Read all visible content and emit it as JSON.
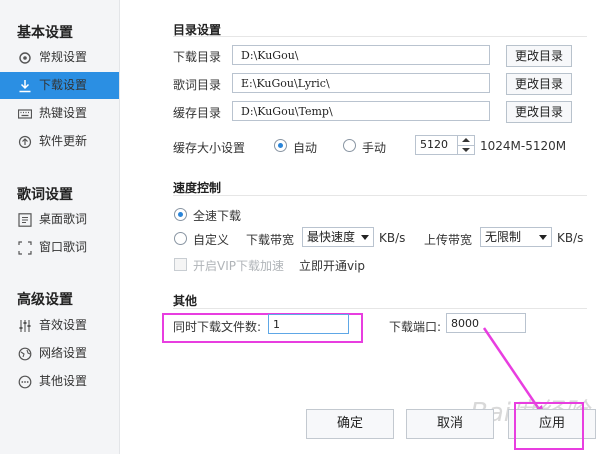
{
  "sidebar": {
    "sections": [
      {
        "title": "基本设置",
        "items": [
          {
            "label": "常规设置",
            "icon": "gear-icon"
          },
          {
            "label": "下载设置",
            "icon": "download-icon",
            "active": true
          },
          {
            "label": "热键设置",
            "icon": "keyboard-icon"
          },
          {
            "label": "软件更新",
            "icon": "update-icon"
          }
        ]
      },
      {
        "title": "歌词设置",
        "items": [
          {
            "label": "桌面歌词",
            "icon": "desktop-lyric-icon"
          },
          {
            "label": "窗口歌词",
            "icon": "window-lyric-icon"
          }
        ]
      },
      {
        "title": "高级设置",
        "items": [
          {
            "label": "音效设置",
            "icon": "equalizer-icon"
          },
          {
            "label": "网络设置",
            "icon": "network-icon"
          },
          {
            "label": "其他设置",
            "icon": "more-icon"
          }
        ]
      }
    ]
  },
  "dirs": {
    "title": "目录设置",
    "rows": [
      {
        "label": "下载目录",
        "value": "D:\\KuGou\\",
        "button": "更改目录"
      },
      {
        "label": "歌词目录",
        "value": "E:\\KuGou\\Lyric\\",
        "button": "更改目录"
      },
      {
        "label": "缓存目录",
        "value": "D:\\KuGou\\Temp\\",
        "button": "更改目录"
      }
    ],
    "cache_size_label": "缓存大小设置",
    "auto_label": "自动",
    "manual_label": "手动",
    "cache_value": "5120",
    "cache_range": "1024M-5120M"
  },
  "speed": {
    "title": "速度控制",
    "full_label": "全速下载",
    "custom_label": "自定义",
    "down_bw_label": "下载带宽",
    "down_bw_value": "最快速度",
    "down_unit": "KB/s",
    "up_bw_label": "上传带宽",
    "up_bw_value": "无限制",
    "up_unit": "KB/s",
    "vip_label": "开启VIP下载加速",
    "vip_link": "立即开通vip"
  },
  "other": {
    "title": "其他",
    "concurrent_label": "同时下载文件数:",
    "concurrent_value": "1",
    "port_label": "下载端口:",
    "port_value": "8000"
  },
  "footer": {
    "ok": "确定",
    "cancel": "取消",
    "apply": "应用"
  },
  "watermark": "Bai度经验",
  "colors": {
    "accent": "#2b8fe3",
    "highlight": "#e83ee0"
  }
}
